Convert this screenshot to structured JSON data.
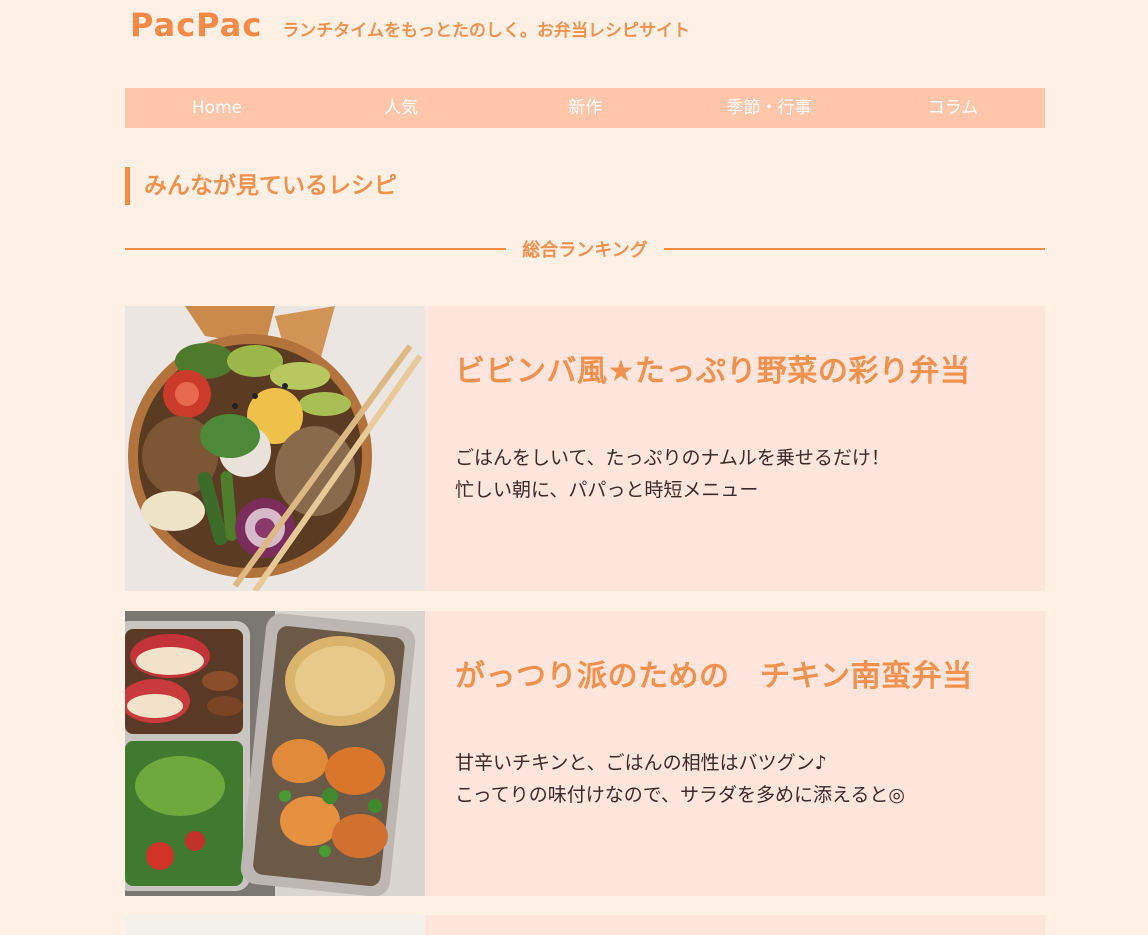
{
  "site": {
    "logo": "PacPac",
    "tagline": "ランチタイムをもっとたのしく。お弁当レシピサイト"
  },
  "nav": {
    "items": [
      {
        "label": "Home"
      },
      {
        "label": "人気"
      },
      {
        "label": "新作"
      },
      {
        "label": "季節・行事"
      },
      {
        "label": "コラム"
      }
    ]
  },
  "section": {
    "title": "みんなが見ているレシピ",
    "ranking_label": "総合ランキング"
  },
  "recipes": [
    {
      "title": "ビビンバ風★たっぷり野菜の彩り弁当",
      "desc_line1": "ごはんをしいて、たっぷりのナムルを乗せるだけ！",
      "desc_line2": "忙しい朝に、パパっと時短メニュー"
    },
    {
      "title": "がっつり派のための　チキン南蛮弁当",
      "desc_line1": "甘辛いチキンと、ごはんの相性はバツグン♪",
      "desc_line2": "こってりの味付けなので、サラダを多めに添えると◎"
    }
  ],
  "colors": {
    "background": "#fff0e6",
    "accent": "#f58a46",
    "nav_bg": "#ffc6a9",
    "card_bg": "#ffe5dc"
  }
}
